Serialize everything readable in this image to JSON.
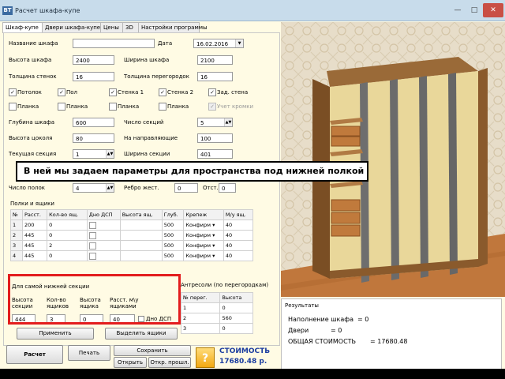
{
  "window": {
    "icon": "BT",
    "title": "Расчет шкафа-купе"
  },
  "tabs": [
    "Шкаф-купе",
    "Двери шкафа-купе",
    "Цены",
    "3D",
    "Настройки программы"
  ],
  "form": {
    "name_label": "Название шкафа",
    "name_value": "",
    "date_label": "Дата",
    "date_value": "16.02.2016",
    "height_label": "Высота шкафа",
    "height_value": "2400",
    "width_label": "Ширина шкафа",
    "width_value": "2100",
    "wall_label": "Толщина стенок",
    "wall_value": "16",
    "partition_label": "Толщина перегородок",
    "partition_value": "16",
    "checks1": [
      {
        "label": "Потолок",
        "checked": true
      },
      {
        "label": "Пол",
        "checked": true
      },
      {
        "label": "Стенка 1",
        "checked": true
      },
      {
        "label": "Стенка 2",
        "checked": true
      },
      {
        "label": "Зад. стена",
        "checked": true
      }
    ],
    "checks2": [
      {
        "label": "Планка",
        "checked": false
      },
      {
        "label": "Планка",
        "checked": false
      },
      {
        "label": "Планка",
        "checked": false
      },
      {
        "label": "Планка",
        "checked": false
      },
      {
        "label": "Учет кромки",
        "checked": true
      }
    ],
    "depth_label": "Глубина шкафа",
    "depth_value": "600",
    "sections_label": "Число секций",
    "sections_value": "5",
    "plinth_label": "Высота цоколя",
    "plinth_value": "80",
    "rail_label": "На направляющие",
    "rail_value": "100",
    "cur_section_label": "Текущая секция",
    "cur_section_value": "1",
    "sec_width_label": "Ширина секции",
    "sec_width_value": "401",
    "shelves_count_label": "Число полок",
    "shelves_count_value": "4",
    "rib_label": "Ребро жест.",
    "rib_value": "0",
    "otst_label": "Отст.",
    "otst_value": "0"
  },
  "shelves": {
    "title": "Полки и ящики",
    "headers": [
      "№",
      "Расст.",
      "Кол-во ящ.",
      "Дно ДСП",
      "Высота ящ.",
      "Глуб.",
      "Крепеж",
      "М/у ящ."
    ],
    "rows": [
      [
        "1",
        "200",
        "0",
        "",
        "",
        "500",
        "Конфирм",
        "40"
      ],
      [
        "2",
        "445",
        "0",
        "",
        "",
        "500",
        "Конфирм",
        "40"
      ],
      [
        "3",
        "445",
        "2",
        "",
        "",
        "500",
        "Конфирм",
        "40"
      ],
      [
        "4",
        "445",
        "0",
        "",
        "",
        "500",
        "Конфирм",
        "40"
      ]
    ]
  },
  "bottom_section": {
    "title": "Для самой нижней секции",
    "headers": [
      "Высота секции",
      "Кол-во ящиков",
      "Высота ящика",
      "Расст. м\\у ящиками"
    ],
    "values": [
      "444",
      "3",
      "0",
      "40"
    ],
    "checkbox_label": "Дно ДСП"
  },
  "antresol": {
    "title": "Антресоли (по перегородкам)",
    "headers": [
      "№ перег.",
      "Высота"
    ],
    "rows": [
      [
        "1",
        "0"
      ],
      [
        "2",
        "560"
      ],
      [
        "3",
        "0"
      ]
    ]
  },
  "tooltip": "В ней мы задаем параметры для пространства под нижней полкой",
  "buttons": {
    "apply": "Применить",
    "highlight": "Выделить ящики",
    "calc": "Расчет",
    "print": "Печать",
    "save": "Сохранить",
    "open": "Открыть",
    "open_prev": "Откр. прошл.",
    "help": "?"
  },
  "cost": {
    "label": "СТОИМОСТЬ",
    "value": "17680.48 р."
  },
  "results": {
    "title": "Результаты",
    "lines": [
      {
        "label": "Наполнение шкафа",
        "value": "= 0"
      },
      {
        "label": "Двери",
        "value": "= 0"
      },
      {
        "label": "ОБЩАЯ СТОИМОСТЬ",
        "value": "= 17680.48"
      }
    ]
  }
}
